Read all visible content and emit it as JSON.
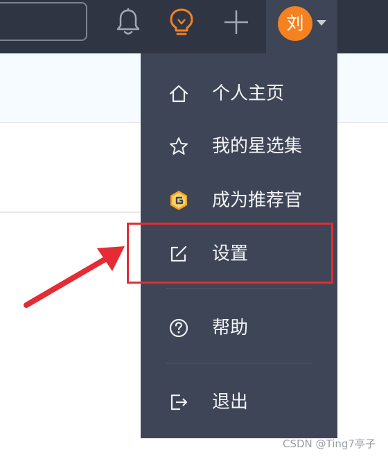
{
  "header": {
    "avatar_text": "刘",
    "icons": [
      "bell-icon",
      "lightbulb-icon",
      "plus-icon",
      "chevron-down-icon"
    ],
    "colors": {
      "bar": "#2f3542",
      "avatar": "#f58220",
      "lightbulb": "#f58220"
    }
  },
  "menu": {
    "items": [
      {
        "label": "个人主页",
        "icon": "home-icon"
      },
      {
        "label": "我的星选集",
        "icon": "star-icon"
      },
      {
        "label": "成为推荐官",
        "icon": "recommender-badge-icon"
      },
      {
        "label": "设置",
        "icon": "edit-settings-icon"
      },
      {
        "label": "帮助",
        "icon": "help-icon"
      },
      {
        "label": "退出",
        "icon": "logout-icon"
      }
    ],
    "colors": {
      "background": "#3e4556",
      "text": "#f2f4f7",
      "badge": "#f5a623"
    }
  },
  "annotation": {
    "highlight_color": "#e52b34"
  },
  "watermark": "CSDN @Ting7亭子"
}
